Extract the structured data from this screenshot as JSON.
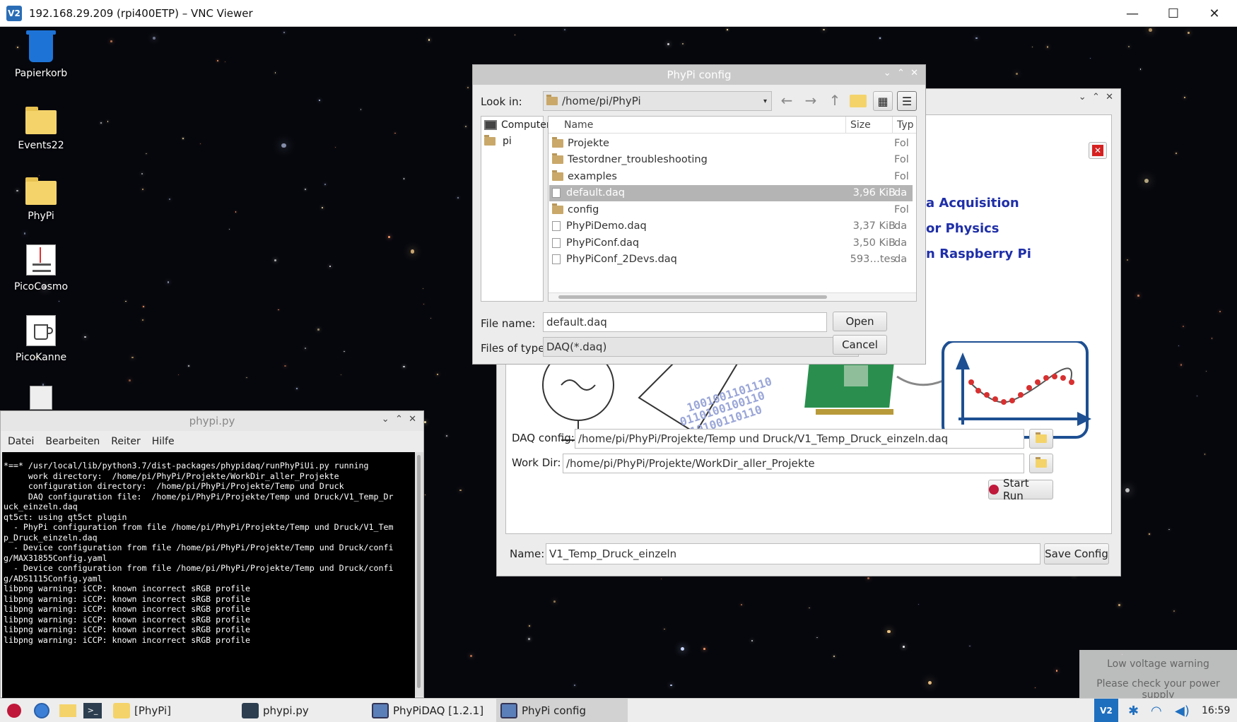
{
  "vnc": {
    "title": "192.168.29.209 (rpi400ETP) – VNC Viewer",
    "logo": "V2"
  },
  "desktop_icons": [
    {
      "label": "Papierkorb",
      "icon": "trash-icon"
    },
    {
      "label": "Events22",
      "icon": "folder-icon"
    },
    {
      "label": "PhyPi",
      "icon": "folder-icon"
    },
    {
      "label": "PicoCosmo",
      "icon": "app-icon"
    },
    {
      "label": "PicoKanne",
      "icon": "app-icon"
    }
  ],
  "file_dialog": {
    "title": "PhyPi config",
    "look_in_label": "Look in:",
    "look_in_value": "/home/pi/PhyPi",
    "places": [
      {
        "label": "Computer",
        "icon": "computer-icon"
      },
      {
        "label": "pi",
        "icon": "folder-icon"
      }
    ],
    "columns": {
      "name": "Name",
      "size": "Size",
      "type": "Typ"
    },
    "files": [
      {
        "name": "Projekte",
        "size": "",
        "type": "Fol",
        "kind": "folder"
      },
      {
        "name": "Testordner_troubleshooting",
        "size": "",
        "type": "Fol",
        "kind": "folder"
      },
      {
        "name": "examples",
        "size": "",
        "type": "Fol",
        "kind": "folder"
      },
      {
        "name": "default.daq",
        "size": "3,96 KiB",
        "type": "da",
        "kind": "file",
        "selected": true
      },
      {
        "name": "config",
        "size": "",
        "type": "Fol",
        "kind": "folder"
      },
      {
        "name": "PhyPiDemo.daq",
        "size": "3,37 KiB",
        "type": "da",
        "kind": "file"
      },
      {
        "name": "PhyPiConf.daq",
        "size": "3,50 KiB",
        "type": "da",
        "kind": "file"
      },
      {
        "name": "PhyPiConf_2Devs.daq",
        "size": "593…tes",
        "type": "da",
        "kind": "file"
      }
    ],
    "file_name_label": "File name:",
    "file_name_value": "default.daq",
    "files_of_type_label": "Files of type:",
    "files_of_type_value": "DAQ(*.daq)",
    "open_label": "Open",
    "cancel_label": "Cancel"
  },
  "phypidaq": {
    "lines": [
      "a Acquisition",
      "or Physics",
      "n Raspberry Pi"
    ],
    "daq_config_label": "DAQ config:",
    "daq_config_value": "/home/pi/PhyPi/Projekte/Temp und Druck/V1_Temp_Druck_einzeln.daq",
    "work_dir_label": "Work Dir:",
    "work_dir_value": "/home/pi/PhyPi/Projekte/WorkDir_aller_Projekte",
    "start_run_label": "Start Run",
    "name_label": "Name:",
    "name_value": "V1_Temp_Druck_einzeln",
    "save_config_label": "Save Config",
    "accent_color": "#1f2fa8"
  },
  "terminal": {
    "title": "phypi.py",
    "menu": [
      "Datei",
      "Bearbeiten",
      "Reiter",
      "Hilfe"
    ],
    "output": "*==* /usr/local/lib/python3.7/dist-packages/phypidaq/runPhyPiUi.py running\n     work directory:  /home/pi/PhyPi/Projekte/WorkDir_aller_Projekte\n     configuration directory:  /home/pi/PhyPi/Projekte/Temp und Druck\n     DAQ configuration file:  /home/pi/PhyPi/Projekte/Temp und Druck/V1_Temp_Dr\nuck_einzeln.daq\nqt5ct: using qt5ct plugin\n  - PhyPi configuration from file /home/pi/PhyPi/Projekte/Temp und Druck/V1_Tem\np_Druck_einzeln.daq\n  - Device configuration from file /home/pi/PhyPi/Projekte/Temp und Druck/confi\ng/MAX31855Config.yaml\n  - Device configuration from file /home/pi/PhyPi/Projekte/Temp und Druck/confi\ng/ADS1115Config.yaml\nlibpng warning: iCCP: known incorrect sRGB profile\nlibpng warning: iCCP: known incorrect sRGB profile\nlibpng warning: iCCP: known incorrect sRGB profile\nlibpng warning: iCCP: known incorrect sRGB profile\nlibpng warning: iCCP: known incorrect sRGB profile\nlibpng warning: iCCP: known incorrect sRGB profile"
  },
  "notification": {
    "title": "Low voltage warning",
    "body": "Please check your power supply"
  },
  "taskbar": {
    "items": [
      {
        "label": "[PhyPi]",
        "icon": "folder-icon"
      },
      {
        "label": "phypi.py",
        "icon": "terminal-icon"
      },
      {
        "label": "PhyPiDAQ [1.2.1]",
        "icon": "window-icon"
      },
      {
        "label": "PhyPi config",
        "icon": "window-icon"
      }
    ],
    "clock": "16:59"
  }
}
